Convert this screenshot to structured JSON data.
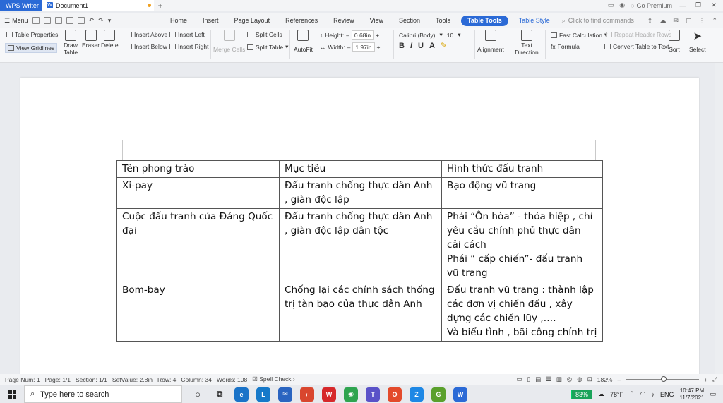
{
  "titlebar": {
    "app_name": "WPS Writer",
    "document_tab": "Document1",
    "new_tab": "+",
    "premium": "Go Premium"
  },
  "menubar": {
    "menu_label": "Menu",
    "tabs": [
      "Home",
      "Insert",
      "Page Layout",
      "References",
      "Review",
      "View",
      "Section",
      "Tools",
      "Table Tools",
      "Table Style"
    ],
    "active_tab": "Table Tools",
    "search_placeholder": "Click to find commands"
  },
  "ribbon": {
    "table_properties": "Table Properties",
    "view_gridlines": "View Gridlines",
    "draw_table": "Draw Table",
    "eraser": "Eraser",
    "delete": "Delete",
    "insert_above": "Insert Above",
    "insert_below": "Insert Below",
    "insert_left": "Insert Left",
    "insert_right": "Insert Right",
    "merge_cells": "Merge Cells",
    "split_cells": "Split Cells",
    "split_table": "Split Table",
    "autofit": "AutoFit",
    "height_label": "Height:",
    "height_value": "0.68in",
    "width_label": "Width:",
    "width_value": "1.97in",
    "font_name": "Calibri (Body)",
    "font_size": "10",
    "alignment": "Alignment",
    "text_direction": "Text Direction",
    "fast_calculation": "Fast Calculation",
    "formula": "Formula",
    "repeat_header_rows": "Repeat Header Rows",
    "convert_table": "Convert Table to Text",
    "sort": "Sort",
    "select": "Select"
  },
  "table": {
    "rows": [
      [
        "Tên phong trào",
        "Mục tiêu",
        "Hình thức đấu tranh"
      ],
      [
        "Xi-pay",
        "Đấu tranh chống thực dân Anh , giàn độc lập",
        "Bạo động vũ trang"
      ],
      [
        "Cuộc đấu tranh của Đảng Quốc đại",
        "Đấu tranh chống thực dân Anh , giàn độc lập dân tộc",
        "Phái “Ôn hòa” - thỏa hiệp , chỉ yêu cầu chính phủ thực dân cải cách\nPhái “ cấp chiến”- đấu tranh vũ trang"
      ],
      [
        "Bom-bay",
        "Chống lại các chính sách thống trị tàn bạo của thực dân Anh",
        "Đấu tranh vũ trang : thành lập các đơn vị chiến đấu , xây dựng các chiến lũy ,….\nVà biểu tình , bãi công chính trị"
      ]
    ]
  },
  "statusbar": {
    "page_num": "Page Num: 1",
    "page": "Page: 1/1",
    "section": "Section: 1/1",
    "setvalue": "SetValue: 2.8in",
    "row": "Row: 4",
    "column": "Column: 34",
    "words": "Words: 108",
    "spell_check": "Spell Check",
    "zoom": "182%"
  },
  "taskbar": {
    "search_placeholder": "Type here to search",
    "battery": "83%",
    "temperature": "78°F",
    "language": "ENG",
    "time": "10:47 PM",
    "date": "11/7/2021"
  },
  "colors": {
    "accent": "#2b6ad6",
    "battery": "#1aa35a",
    "unsaved_dot": "#f0a020"
  }
}
